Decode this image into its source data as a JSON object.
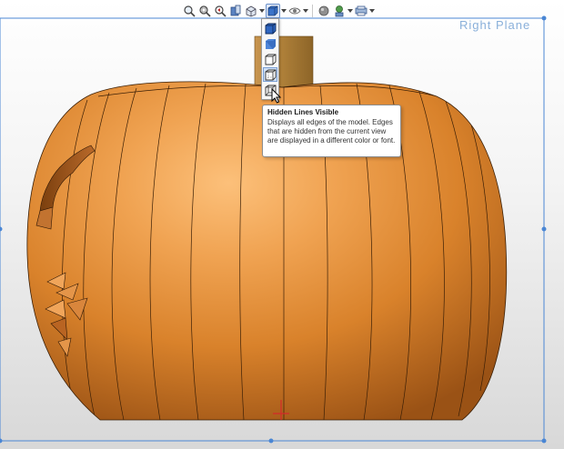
{
  "plane_label": "Right Plane",
  "toolbar": {
    "icons": [
      "zoom-to-fit-icon",
      "zoom-to-area-icon",
      "previous-view-icon",
      "section-view-icon",
      "view-orientation-icon",
      "display-style-icon",
      "hide-show-items-icon",
      "edit-appearance-icon",
      "apply-scene-icon",
      "view-settings-icon"
    ]
  },
  "display_style_flyout": [
    "shaded-with-edges",
    "shaded",
    "hidden-lines-removed",
    "hidden-lines-visible",
    "wireframe"
  ],
  "tooltip": {
    "title": "Hidden Lines Visible",
    "body": "Displays all edges of the model. Edges that are hidden from the current view are displayed in a different color or font."
  },
  "colors": {
    "pumpkin": "#d9822b",
    "pumpkin_light": "#f6b062",
    "pumpkin_dark": "#8a4a12",
    "plane": "#4a86d4",
    "stem": "#b0813a"
  }
}
